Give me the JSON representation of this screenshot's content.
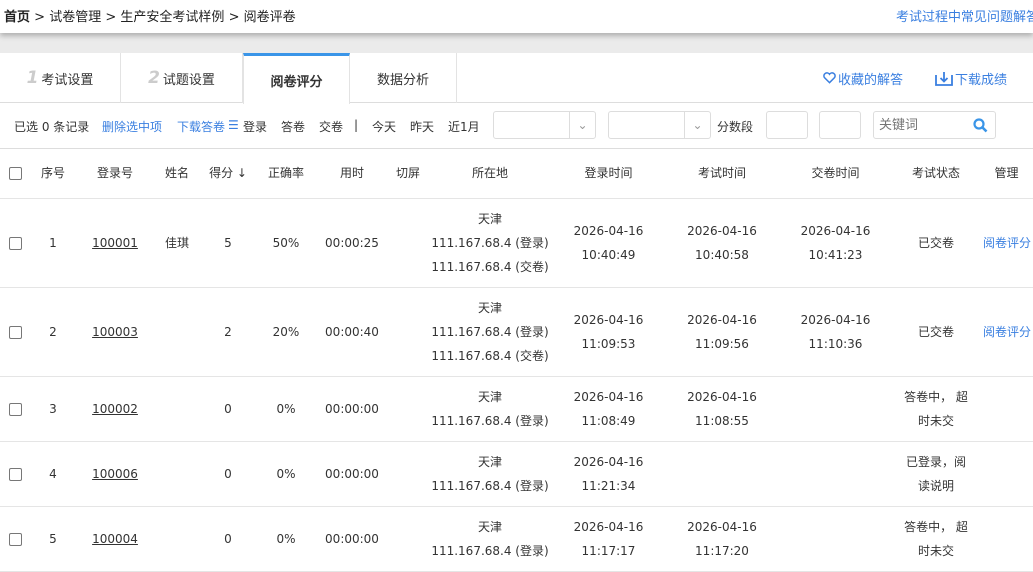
{
  "breadcrumb": {
    "home": "首页",
    "sep": ">",
    "items": [
      "试卷管理",
      "生产安全考试样例",
      "阅卷评卷"
    ]
  },
  "faq_link": "考试过程中常见问题解答",
  "tabs": [
    {
      "num": "1",
      "label": "考试设置"
    },
    {
      "num": "2",
      "label": "试题设置"
    },
    {
      "num": "",
      "label": "阅卷评分"
    },
    {
      "num": "",
      "label": "数据分析"
    }
  ],
  "tab_actions": {
    "favorites": "收藏的解答",
    "download": "下载成绩"
  },
  "filter": {
    "selected": "已选 0 条记录",
    "delete": "删除选中项",
    "download_sheets": "下载答卷",
    "menu_icon": "☰",
    "status": [
      "登录",
      "答卷",
      "交卷"
    ],
    "divider": "|",
    "dates": [
      "今天",
      "昨天",
      "近1月"
    ],
    "score_range": "分数段",
    "keyword_placeholder": "关键词"
  },
  "columns": [
    "序号",
    "登录号",
    "姓名",
    "得分 ↓",
    "正确率",
    "用时",
    "切屏",
    "所在地",
    "登录时间",
    "考试时间",
    "交卷时间",
    "考试状态",
    "管理"
  ],
  "rows": [
    {
      "no": "1",
      "id": "100001",
      "name": "佳琪",
      "score": "5",
      "rate": "50%",
      "time": "00:00:25",
      "switch": "",
      "loc": [
        "天津",
        "111.167.68.4 (登录)",
        "111.167.68.4 (交卷)"
      ],
      "login": [
        "2026-04-16",
        "10:40:49"
      ],
      "exam": [
        "2026-04-16",
        "10:40:58"
      ],
      "submit": [
        "2026-04-16",
        "10:41:23"
      ],
      "status": "已交卷",
      "manage": "阅卷评分"
    },
    {
      "no": "2",
      "id": "100003",
      "name": "",
      "score": "2",
      "rate": "20%",
      "time": "00:00:40",
      "switch": "",
      "loc": [
        "天津",
        "111.167.68.4 (登录)",
        "111.167.68.4 (交卷)"
      ],
      "login": [
        "2026-04-16",
        "11:09:53"
      ],
      "exam": [
        "2026-04-16",
        "11:09:56"
      ],
      "submit": [
        "2026-04-16",
        "11:10:36"
      ],
      "status": "已交卷",
      "manage": "阅卷评分"
    },
    {
      "no": "3",
      "id": "100002",
      "name": "",
      "score": "0",
      "rate": "0%",
      "time": "00:00:00",
      "switch": "",
      "loc": [
        "天津",
        "111.167.68.4 (登录)"
      ],
      "login": [
        "2026-04-16",
        "11:08:49"
      ],
      "exam": [
        "2026-04-16",
        "11:08:55"
      ],
      "submit": [],
      "status": "答卷中， 超时未交",
      "manage": ""
    },
    {
      "no": "4",
      "id": "100006",
      "name": "",
      "score": "0",
      "rate": "0%",
      "time": "00:00:00",
      "switch": "",
      "loc": [
        "天津",
        "111.167.68.4 (登录)"
      ],
      "login": [
        "2026-04-16",
        "11:21:34"
      ],
      "exam": [],
      "submit": [],
      "status": "已登录，阅读说明",
      "manage": ""
    },
    {
      "no": "5",
      "id": "100004",
      "name": "",
      "score": "0",
      "rate": "0%",
      "time": "00:00:00",
      "switch": "",
      "loc": [
        "天津",
        "111.167.68.4 (登录)"
      ],
      "login": [
        "2026-04-16",
        "11:17:17"
      ],
      "exam": [
        "2026-04-16",
        "11:17:20"
      ],
      "submit": [],
      "status": "答卷中， 超时未交",
      "manage": ""
    }
  ]
}
